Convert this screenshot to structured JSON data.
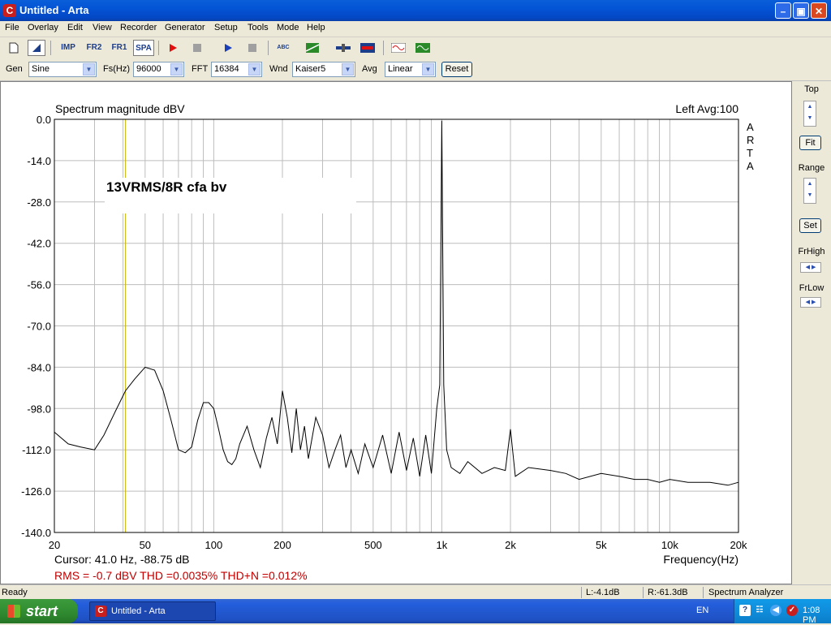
{
  "window": {
    "title": "Untitled - Arta",
    "app_icon_glyph": "C"
  },
  "menu": [
    "File",
    "Overlay",
    "Edit",
    "View",
    "Recorder",
    "Generator",
    "Setup",
    "Tools",
    "Mode",
    "Help"
  ],
  "toolbar": {
    "imp": "IMP",
    "fr2": "FR2",
    "fr1": "FR1",
    "spa": "SPA",
    "abc": "ABC"
  },
  "params": {
    "gen_label": "Gen",
    "gen_value": "Sine",
    "fs_label": "Fs(Hz)",
    "fs_value": "96000",
    "fft_label": "FFT",
    "fft_value": "16384",
    "wnd_label": "Wnd",
    "wnd_value": "Kaiser5",
    "avg_label": "Avg",
    "avg_value": "Linear",
    "reset_label": "Reset"
  },
  "right_panel": {
    "top_label": "Top",
    "fit_label": "Fit",
    "range_label": "Range",
    "set_label": "Set",
    "frhigh_label": "FrHigh",
    "frlow_label": "FrLow"
  },
  "plot": {
    "cursor_text": "Cursor:    41.0 Hz, -88.75 dB",
    "metrics_text": "RMS =   -0.7 dBV   THD =0.0035%   THD+N =0.012%",
    "arta_letters": [
      "A",
      "R",
      "T",
      "A"
    ]
  },
  "chart_data": {
    "type": "line",
    "title": "Spectrum magnitude dBV",
    "title_right": "Left  Avg:100",
    "annotation": "13VRMS/8R cfa bv",
    "xlabel": "Frequency(Hz)",
    "ylabel": "",
    "x_scale": "log",
    "xlim": [
      20,
      20000
    ],
    "ylim": [
      -140,
      0
    ],
    "yticks": [
      0,
      -14,
      -28,
      -42,
      -56,
      -70,
      -84,
      -98,
      -112,
      -126,
      -140
    ],
    "ytick_labels": [
      "0.0",
      "-14.0",
      "-28.0",
      "-42.0",
      "-56.0",
      "-70.0",
      "-84.0",
      "-98.0",
      "-112.0",
      "-126.0",
      "-140.0"
    ],
    "xticks": [
      20,
      50,
      100,
      200,
      500,
      1000,
      2000,
      5000,
      10000,
      20000
    ],
    "xtick_labels": [
      "20",
      "50",
      "100",
      "200",
      "500",
      "1k",
      "2k",
      "5k",
      "10k",
      "20k"
    ],
    "grid": true,
    "cursor_hz": 41.0,
    "colors": {
      "trace": "#000000",
      "cursor": "#c8b400",
      "metrics": "#c00000",
      "grid": "#bdbdbd"
    },
    "series": [
      {
        "x": [
          20,
          23,
          26,
          30,
          33,
          37,
          41,
          45,
          50,
          55,
          60,
          65,
          70,
          75,
          80,
          85,
          90,
          95,
          100,
          105,
          110,
          115,
          120,
          125,
          130,
          140,
          150,
          160,
          170,
          180,
          190,
          200,
          210,
          220,
          230,
          240,
          250,
          260,
          280,
          300,
          320,
          340,
          360,
          380,
          400,
          430,
          460,
          500,
          550,
          600,
          650,
          700,
          750,
          800,
          850,
          900,
          950,
          980,
          1000,
          1020,
          1050,
          1100,
          1200,
          1300,
          1500,
          1700,
          1900,
          2000,
          2100,
          2400,
          3000,
          3500,
          4000,
          5000,
          6000,
          7000,
          8000,
          9000,
          10000,
          12000,
          15000,
          18000,
          20000
        ],
        "y": [
          -106,
          -110,
          -111,
          -112,
          -107,
          -99,
          -92,
          -88,
          -84,
          -85,
          -92,
          -102,
          -112,
          -113,
          -111,
          -102,
          -96,
          -96,
          -98,
          -105,
          -112,
          -116,
          -117,
          -115,
          -110,
          -104,
          -112,
          -118,
          -108,
          -101,
          -110,
          -92,
          -101,
          -113,
          -98,
          -112,
          -104,
          -115,
          -101,
          -107,
          -118,
          -112,
          -107,
          -118,
          -112,
          -120,
          -110,
          -118,
          -107,
          -120,
          -106,
          -119,
          -108,
          -121,
          -107,
          -120,
          -98,
          -90,
          -0.5,
          -90,
          -112,
          -118,
          -120,
          -116,
          -120,
          -118,
          -119,
          -105,
          -121,
          -118,
          -119,
          -120,
          -122,
          -120,
          -121,
          -122,
          -122,
          -123,
          -122,
          -123,
          -123,
          -124,
          -123
        ]
      }
    ]
  },
  "status": {
    "ready": "Ready",
    "left": "L:-4.1dB",
    "right": "R:-61.3dB",
    "mode": "Spectrum Analyzer"
  },
  "taskbar": {
    "start": "start",
    "task_item": "Untitled - Arta",
    "lang": "EN",
    "clock": "1:08 PM"
  }
}
